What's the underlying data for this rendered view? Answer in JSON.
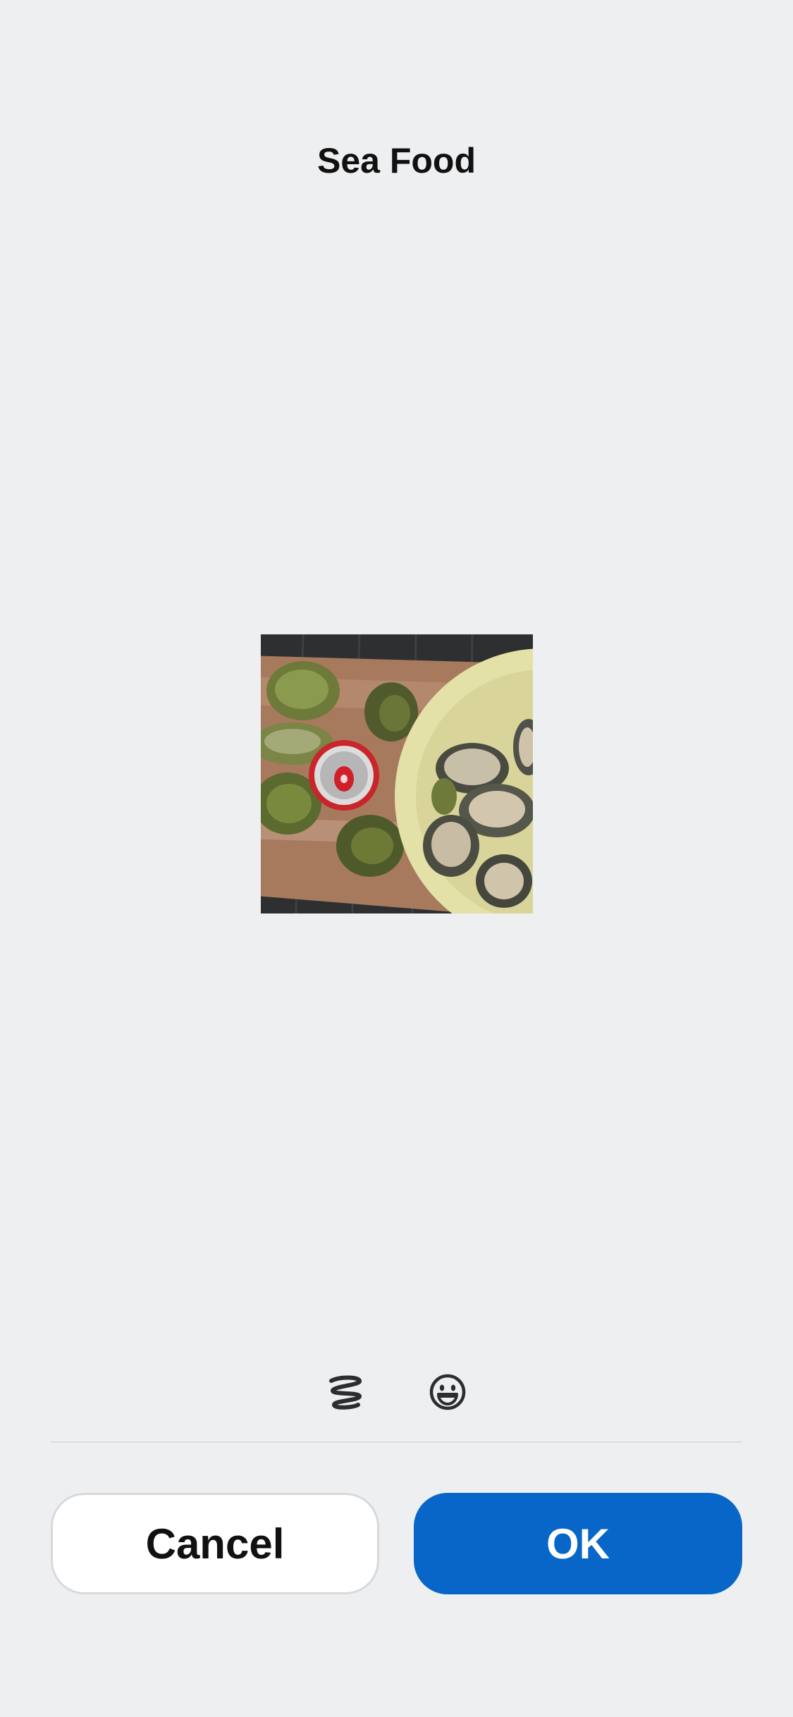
{
  "header": {
    "title": "Sea Food"
  },
  "image": {
    "subject": "oysters-on-board-and-plate-with-can"
  },
  "toolbar": {
    "tools": [
      {
        "name": "scribble",
        "icon": "scribble-icon"
      },
      {
        "name": "emoji",
        "icon": "emoji-smile-icon"
      }
    ]
  },
  "actions": {
    "cancel_label": "Cancel",
    "ok_label": "OK"
  },
  "colors": {
    "background": "#eeeff1",
    "accent": "#0866c8",
    "button_white": "#ffffff"
  }
}
